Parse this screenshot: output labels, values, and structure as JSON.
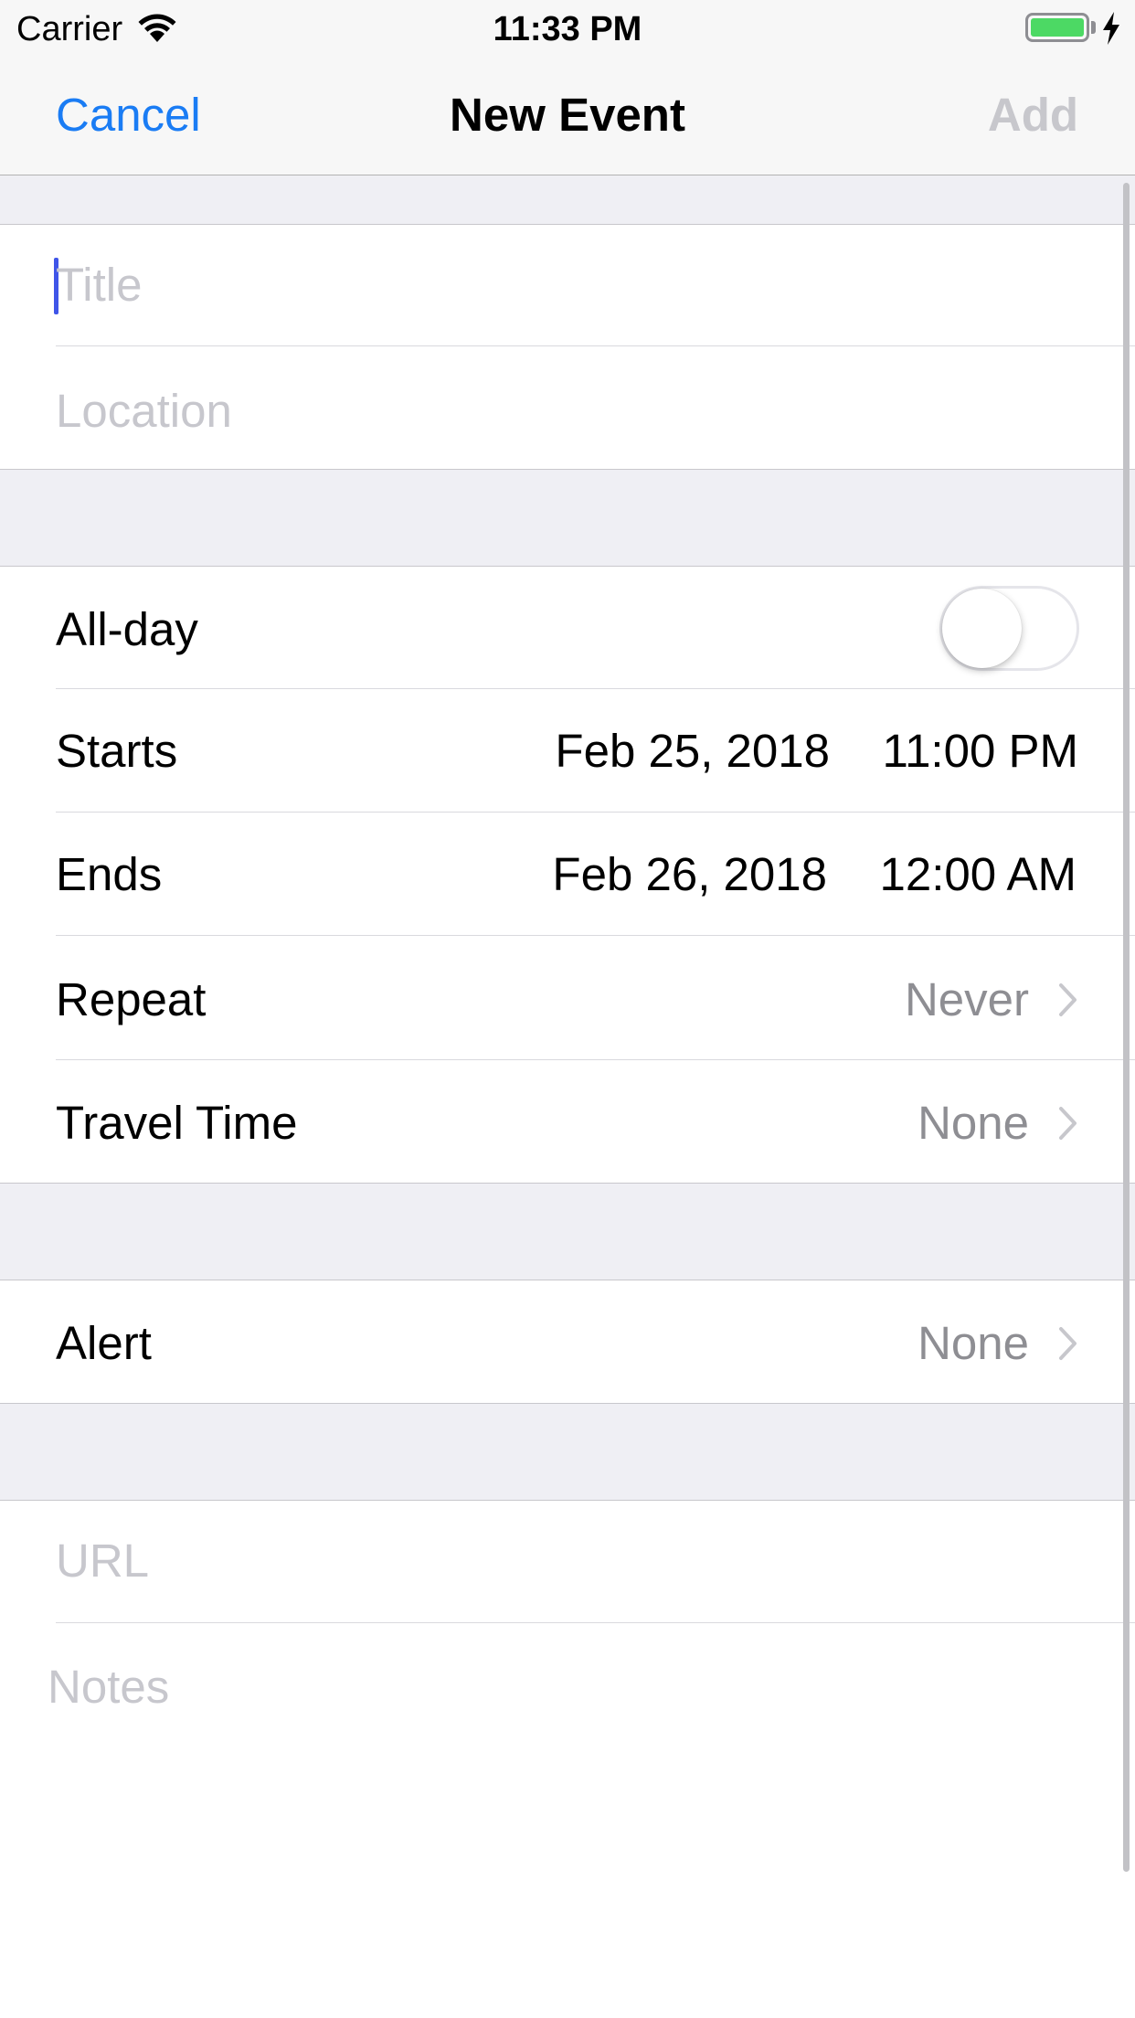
{
  "status_bar": {
    "carrier": "Carrier",
    "time": "11:33 PM",
    "wifi_icon": "wifi-icon",
    "battery_icon": "battery-icon",
    "charging_icon": "bolt-icon",
    "battery_level": 1.0,
    "battery_color": "#4cd964"
  },
  "nav": {
    "cancel_label": "Cancel",
    "title": "New Event",
    "add_label": "Add",
    "accent_color": "#1a7cf4",
    "disabled_color": "#c7c7cc"
  },
  "form": {
    "title_placeholder": "Title",
    "location_placeholder": "Location",
    "all_day": {
      "label": "All-day",
      "on": false
    },
    "starts": {
      "label": "Starts",
      "date": "Feb 25, 2018",
      "time": "11:00 PM"
    },
    "ends": {
      "label": "Ends",
      "date": "Feb 26, 2018",
      "time": "12:00 AM"
    },
    "repeat": {
      "label": "Repeat",
      "value": "Never"
    },
    "travel_time": {
      "label": "Travel Time",
      "value": "None"
    },
    "alert": {
      "label": "Alert",
      "value": "None"
    },
    "url_placeholder": "URL",
    "notes_placeholder": "Notes"
  }
}
